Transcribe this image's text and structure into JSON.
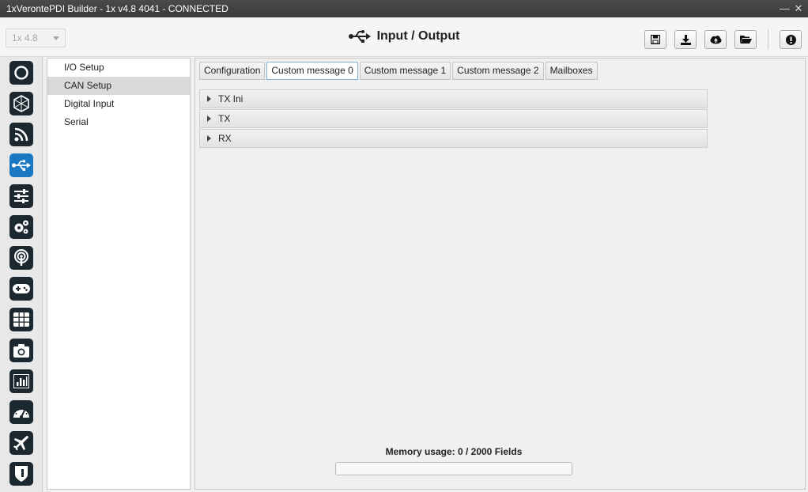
{
  "window": {
    "title": "1xVerontePDI Builder - 1x v4.8 4041 - CONNECTED",
    "controls": [
      "minimize-icon",
      "close-icon"
    ]
  },
  "header": {
    "version_select": "1x 4.8",
    "page_title": "Input / Output",
    "page_icon": "usb-icon",
    "toolbar": [
      "save-icon",
      "download-icon",
      "cloud-upload-icon",
      "folder-open-icon",
      "alert-icon"
    ]
  },
  "sidebar": {
    "icons": [
      "circle-icon",
      "hex-network-icon",
      "rss-icon",
      "usb-icon",
      "sliders-icon",
      "gears-icon",
      "broadcast-icon",
      "gamepad-icon",
      "grid-icon",
      "camera-icon",
      "bar-chart-icon",
      "gauge-icon",
      "airplane-icon",
      "shield-icon"
    ],
    "active_index": 3,
    "active_color": "#1a78c2",
    "icon_color": "#1b2830"
  },
  "nav": {
    "items": [
      {
        "label": "I/O Setup"
      },
      {
        "label": "CAN Setup"
      },
      {
        "label": "Digital Input"
      },
      {
        "label": "Serial"
      }
    ],
    "selected_index": 1
  },
  "tabs": {
    "items": [
      {
        "label": "Configuration"
      },
      {
        "label": "Custom message 0"
      },
      {
        "label": "Custom message 1"
      },
      {
        "label": "Custom message 2"
      },
      {
        "label": "Mailboxes"
      }
    ],
    "active_index": 1
  },
  "sections": [
    {
      "label": "TX Ini"
    },
    {
      "label": "TX"
    },
    {
      "label": "RX"
    }
  ],
  "memory": {
    "label": "Memory usage: 0 / 2000 Fields",
    "fraction": 0
  }
}
